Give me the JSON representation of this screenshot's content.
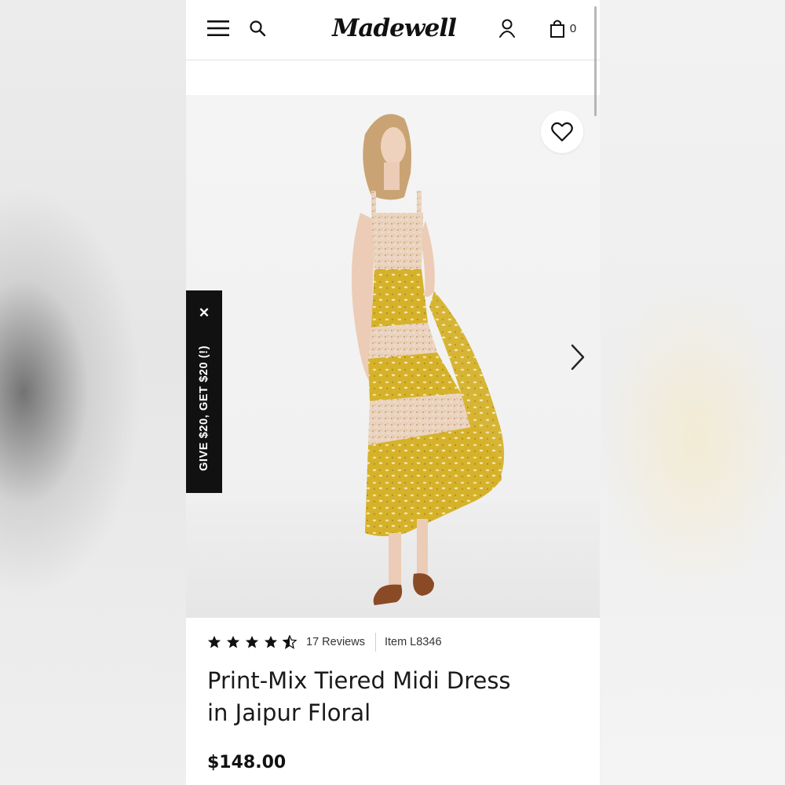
{
  "header": {
    "brand": "Madewell",
    "bag_count": "0",
    "icons": [
      "menu-icon",
      "search-icon",
      "account-icon",
      "bag-icon"
    ]
  },
  "gallery": {
    "icons": [
      "heart-icon",
      "chevron-right-icon"
    ]
  },
  "referral": {
    "text": "GIVE $20, GET $20 (!)",
    "close_label": "✕"
  },
  "product": {
    "rating": 4.5,
    "rating_max": 5,
    "reviews_label": "17 Reviews",
    "item_label": "Item L8346",
    "title_line1": "Print-Mix Tiered Midi Dress",
    "title_line2": "in Jaipur Floral",
    "price": "$148.00"
  },
  "colors": {
    "accent_dark": "#111111",
    "dress_yellow": "#d8b42c",
    "dress_pink": "#e8cdb8"
  }
}
